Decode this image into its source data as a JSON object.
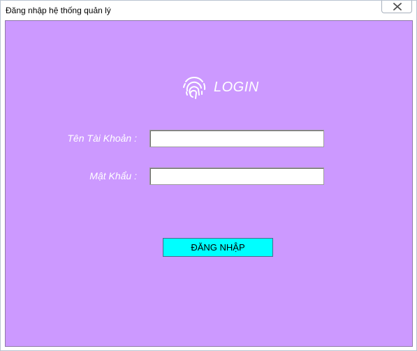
{
  "window": {
    "title": "Đăng nhập hệ thống quản lý"
  },
  "logo": {
    "icon": "fingerprint-icon",
    "text": "LOGIN"
  },
  "form": {
    "username_label": "Tên Tài Khoản :",
    "username_value": "",
    "password_label": "Mật Khẩu :",
    "password_value": "",
    "submit_label": "ĐĂNG NHẬP"
  },
  "colors": {
    "panel_background": "#cc99ff",
    "button_background": "#00ffff",
    "label_text": "#ffffff"
  }
}
